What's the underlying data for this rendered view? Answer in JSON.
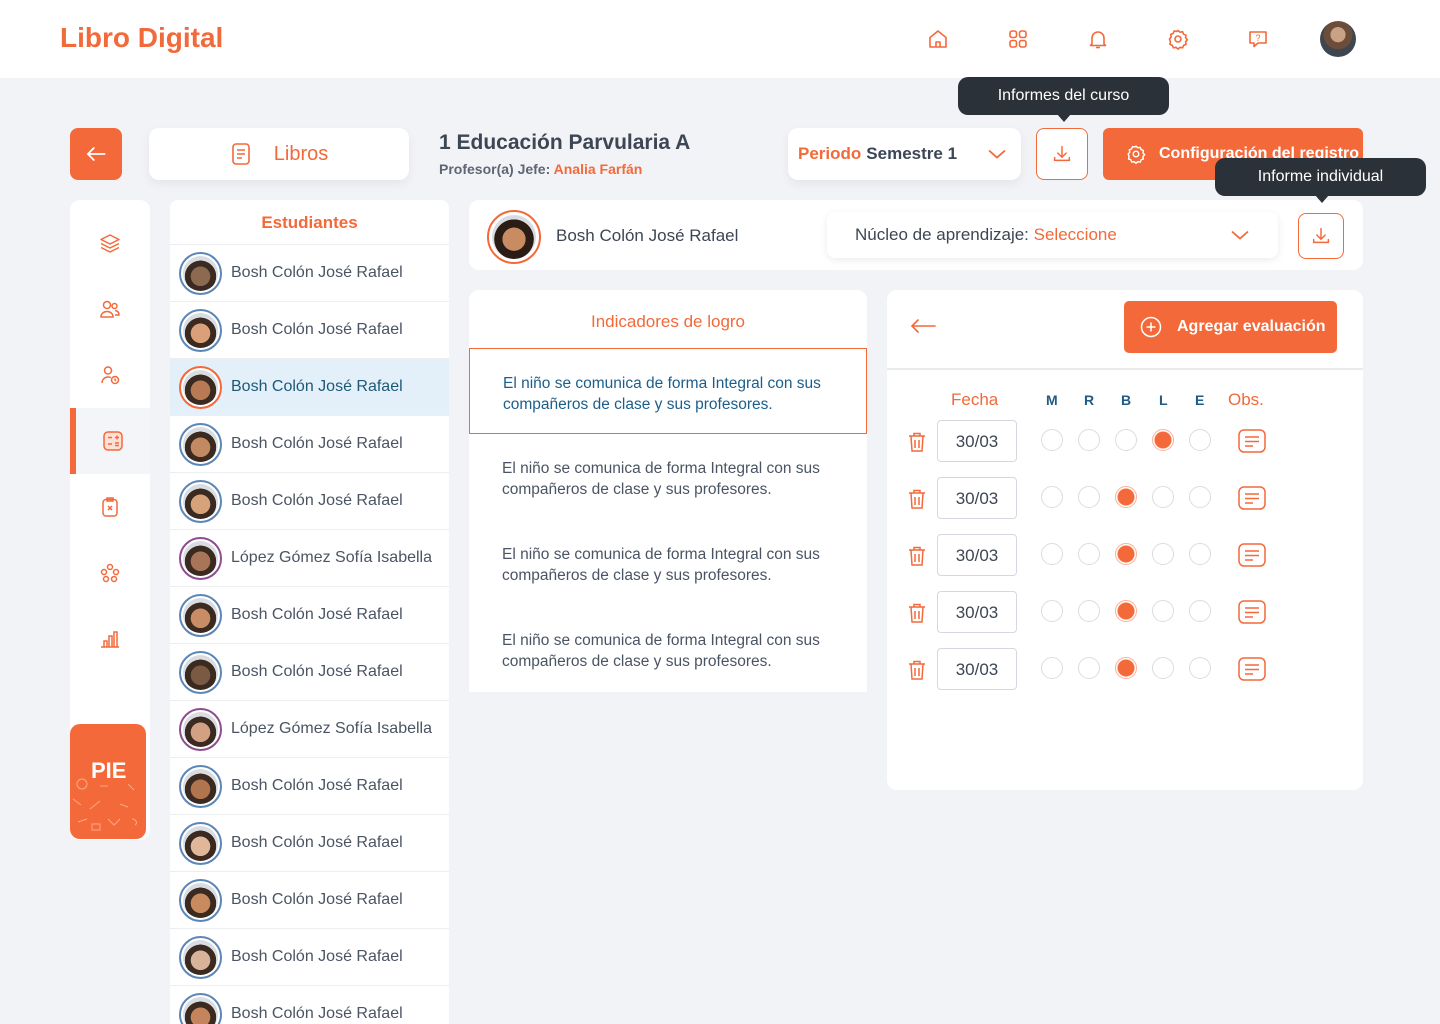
{
  "app": {
    "title": "Libro Digital"
  },
  "top_icons": [
    "home-icon",
    "grid-icon",
    "bell-icon",
    "settings-icon",
    "help-icon"
  ],
  "nav": {
    "libros_label": "Libros"
  },
  "course": {
    "title": "1 Educación Parvularia A",
    "teacher_label": "Profesor(a) Jefe:",
    "teacher_name": "Analia Farfán"
  },
  "periodo": {
    "label": "Periodo",
    "value": "Semestre 1"
  },
  "tooltips": {
    "course_report": "Informes del curso",
    "individual_report": "Informe individual"
  },
  "config_button": "Configuración del registro",
  "sidebar": {
    "pie_label": "PIE"
  },
  "students": {
    "header": "Estudiantes",
    "items": [
      {
        "name": "Bosh Colón José Rafael",
        "color": "#8b6a4f"
      },
      {
        "name": "Bosh Colón José Rafael",
        "color": "#d9a079"
      },
      {
        "name": "Bosh Colón José Rafael",
        "color": "#b77a55"
      },
      {
        "name": "Bosh Colón José Rafael",
        "color": "#c28a62"
      },
      {
        "name": "Bosh Colón José Rafael",
        "color": "#d6a27a"
      },
      {
        "name": "López Gómez Sofía Isabella",
        "color": "#a87558"
      },
      {
        "name": "Bosh Colón José Rafael",
        "color": "#c98d66"
      },
      {
        "name": "Bosh Colón José Rafael",
        "color": "#7b5a43"
      },
      {
        "name": "López Gómez Sofía Isabella",
        "color": "#d2a184"
      },
      {
        "name": "Bosh Colón José Rafael",
        "color": "#b0744f"
      },
      {
        "name": "Bosh Colón José Rafael",
        "color": "#e0b799"
      },
      {
        "name": "Bosh Colón José Rafael",
        "color": "#c78b5f"
      },
      {
        "name": "Bosh Colón José Rafael",
        "color": "#d8b39a"
      },
      {
        "name": "Bosh Colón José Rafael",
        "color": "#c4845c"
      }
    ]
  },
  "current_student": {
    "name": "Bosh Colón José Rafael"
  },
  "nucleo": {
    "label": "Núcleo de aprendizaje:",
    "value": "Seleccione"
  },
  "indicators": {
    "header": "Indicadores de logro",
    "items": [
      "El niño se comunica de forma Integral con sus compañeros de clase y sus profesores.",
      "El niño se comunica de forma Integral con sus compañeros de clase y sus profesores.",
      "El niño se comunica de forma Integral con sus compañeros de clase y sus profesores.",
      "El niño se comunica de forma Integral con sus compañeros de clase y sus profesores."
    ]
  },
  "evaluation": {
    "add_label": "Agregar evaluación",
    "columns": {
      "fecha": "Fecha",
      "m": "M",
      "r": "R",
      "b": "B",
      "l": "L",
      "e": "E",
      "obs": "Obs."
    },
    "rows": [
      {
        "date": "30/03",
        "selected": "L"
      },
      {
        "date": "30/03",
        "selected": "B"
      },
      {
        "date": "30/03",
        "selected": "B"
      },
      {
        "date": "30/03",
        "selected": "B"
      },
      {
        "date": "30/03",
        "selected": "B"
      }
    ]
  },
  "colors": {
    "accent": "#f4693a",
    "selected_row": "#e3f0fa",
    "tooltip": "#2b3138"
  }
}
